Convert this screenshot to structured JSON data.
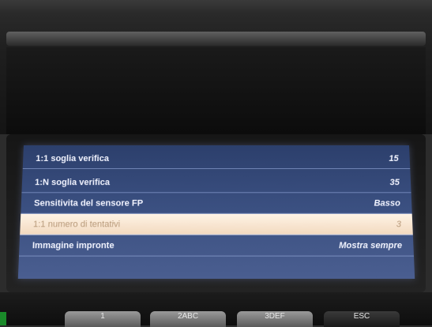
{
  "menu": {
    "rows": [
      {
        "label": "1:1 soglia verifica",
        "value": "15"
      },
      {
        "label": "1:N soglia verifica",
        "value": "35"
      },
      {
        "label": "Sensitivita del sensore FP",
        "value": "Basso"
      },
      {
        "label": "1:1 numero di tentativi",
        "value": "3"
      },
      {
        "label": "Immagine impronte",
        "value": "Mostra sempre"
      }
    ],
    "selected_index": 3
  },
  "keypad": {
    "keys": [
      "1",
      "2ABC",
      "3DEF",
      "ESC"
    ]
  },
  "colors": {
    "screen_bg": "#3a4f80",
    "row_text": "#f2f4ff",
    "selected_bg": "#f7e3cf",
    "selected_text": "#b89a7a"
  }
}
